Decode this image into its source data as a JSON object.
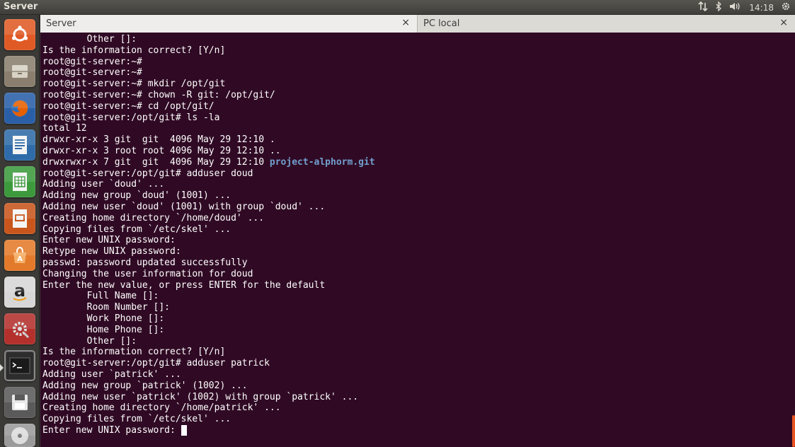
{
  "panel": {
    "app_title": "Server",
    "clock": "14:18"
  },
  "launcher": {
    "items": [
      {
        "name": "dash-home",
        "color": "#e05a26"
      },
      {
        "name": "files",
        "color": "#8a7f6e"
      },
      {
        "name": "firefox",
        "color": "#e66000"
      },
      {
        "name": "writer",
        "color": "#2f6ba8"
      },
      {
        "name": "calc",
        "color": "#3c9a3c"
      },
      {
        "name": "impress",
        "color": "#c8561c"
      },
      {
        "name": "software-center",
        "color": "#e37a2b"
      },
      {
        "name": "amazon",
        "color": "#d7d7d7",
        "glyph": "a"
      },
      {
        "name": "system-settings",
        "color": "#b3302d"
      },
      {
        "name": "terminal",
        "color": "#2d2d2d",
        "glyph": ">_"
      },
      {
        "name": "save-disk",
        "color": "#5a5a5a"
      },
      {
        "name": "dvd",
        "color": "#9a9a9a"
      }
    ]
  },
  "terminal": {
    "tabs": [
      {
        "label": "Server",
        "close": "×"
      },
      {
        "label": "PC local",
        "close": "×"
      }
    ],
    "lines": [
      "        Other []:",
      "Is the information correct? [Y/n]",
      "root@git-server:~#",
      "root@git-server:~#",
      "root@git-server:~# mkdir /opt/git",
      "root@git-server:~# chown -R git: /opt/git/",
      "root@git-server:~# cd /opt/git/",
      "root@git-server:/opt/git# ls -la",
      "total 12",
      "drwxr-xr-x 3 git  git  4096 May 29 12:10 .",
      "drwxr-xr-x 3 root root 4096 May 29 12:10 ..",
      "drwxrwxr-x 7 git  git  4096 May 29 12:10 ",
      "root@git-server:/opt/git# adduser doud",
      "Adding user `doud' ...",
      "Adding new group `doud' (1001) ...",
      "Adding new user `doud' (1001) with group `doud' ...",
      "Creating home directory `/home/doud' ...",
      "Copying files from `/etc/skel' ...",
      "Enter new UNIX password:",
      "Retype new UNIX password:",
      "passwd: password updated successfully",
      "Changing the user information for doud",
      "Enter the new value, or press ENTER for the default",
      "        Full Name []:",
      "        Room Number []:",
      "        Work Phone []:",
      "        Home Phone []:",
      "        Other []:",
      "Is the information correct? [Y/n]",
      "root@git-server:/opt/git# adduser patrick",
      "Adding user `patrick' ...",
      "Adding new group `patrick' (1002) ...",
      "Adding new user `patrick' (1002) with group `patrick' ...",
      "Creating home directory `/home/patrick' ...",
      "Copying files from `/etc/skel' ...",
      "Enter new UNIX password: "
    ],
    "dir_entry": "project-alphorm.git",
    "colors": {
      "background": "#300a24",
      "text": "#ffffff",
      "directory": "#729fcf"
    }
  }
}
